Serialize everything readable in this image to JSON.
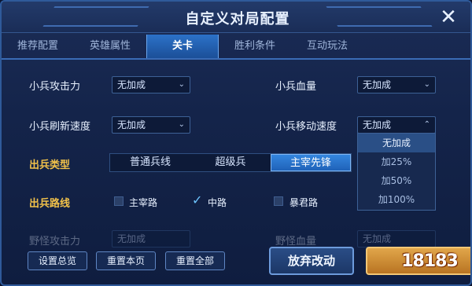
{
  "title": "自定义对局配置",
  "tabs": [
    {
      "label": "推荐配置"
    },
    {
      "label": "英雄属性"
    },
    {
      "label": "关卡"
    },
    {
      "label": "胜利条件"
    },
    {
      "label": "互动玩法"
    }
  ],
  "active_tab": "关卡",
  "rows": {
    "minion_attack": {
      "label": "小兵攻击力",
      "value": "无加成"
    },
    "minion_hp": {
      "label": "小兵血量",
      "value": "无加成"
    },
    "minion_refresh": {
      "label": "小兵刷新速度",
      "value": "无加成"
    },
    "minion_move": {
      "label": "小兵移动速度",
      "value": "无加成"
    },
    "minion_type": {
      "label": "出兵类型"
    },
    "minion_lane": {
      "label": "出兵路线"
    },
    "hidden1": {
      "label": "野怪攻击力",
      "value": "无加成"
    },
    "hidden2": {
      "label": "野怪血量",
      "value": "无加成"
    }
  },
  "dropdown_options": [
    "无加成",
    "加25%",
    "加50%",
    "加100%"
  ],
  "minion_type_options": [
    "普通兵线",
    "超级兵",
    "主宰先锋"
  ],
  "minion_type_selected": "主宰先锋",
  "lanes": [
    {
      "label": "主宰路",
      "checked": false
    },
    {
      "label": "中路",
      "checked": true
    },
    {
      "label": "暴君路",
      "checked": false
    }
  ],
  "buttons": {
    "overview": "设置总览",
    "reset_page": "重置本页",
    "reset_all": "重置全部",
    "discard": "放弃改动"
  },
  "watermark": "18183",
  "colors": {
    "gold": "#f2c24a",
    "accent": "#2c72c8"
  }
}
